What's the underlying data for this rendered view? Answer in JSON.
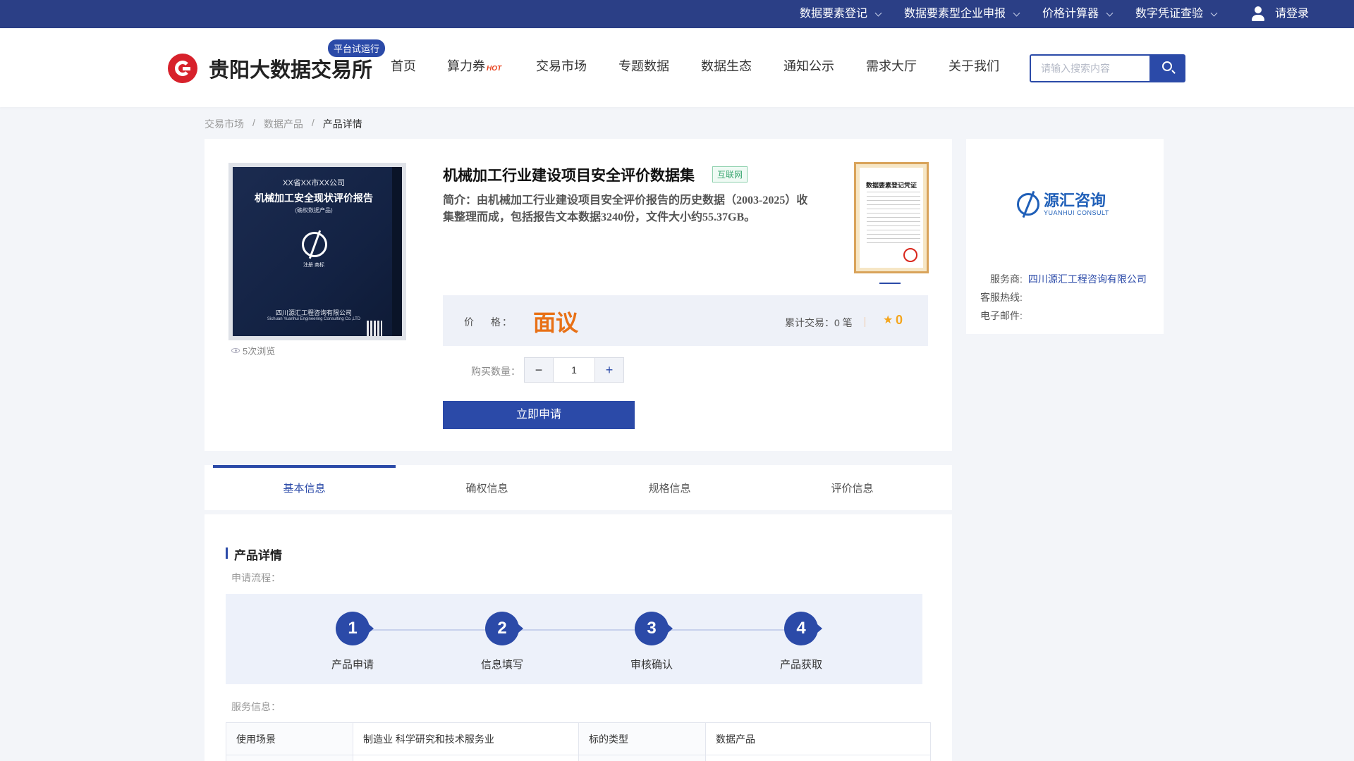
{
  "topbar": {
    "items": [
      {
        "label": "数据要素登记"
      },
      {
        "label": "数据要素型企业申报"
      },
      {
        "label": "价格计算器"
      },
      {
        "label": "数字凭证查验"
      }
    ],
    "login": "请登录"
  },
  "header": {
    "logo_text": "贵阳大数据交易所",
    "trial_badge": "平台试运行",
    "nav": [
      {
        "label": "首页"
      },
      {
        "label": "算力券",
        "badge": "HOT"
      },
      {
        "label": "交易市场"
      },
      {
        "label": "专题数据"
      },
      {
        "label": "数据生态"
      },
      {
        "label": "通知公示"
      },
      {
        "label": "需求大厅"
      },
      {
        "label": "关于我们"
      }
    ],
    "search_placeholder": "请输入搜索内容"
  },
  "breadcrumb": [
    "交易市场",
    "数据产品",
    "产品详情"
  ],
  "breadcrumb_sep": "/",
  "product": {
    "cover": {
      "line1": "XX省XX市XX公司",
      "line2": "机械加工安全现状评价报告",
      "line3": "(确权数据产品)",
      "logo_label": "注册  商标",
      "company": "四川源汇工程咨询有限公司",
      "company_en": "Sichuan Yuanhui Engineering Consulting Co.,LTD"
    },
    "views": "5次浏览",
    "title": "机械加工行业建设项目安全评价数据集",
    "tag": "互联网",
    "description": "简介：由机械加工行业建设项目安全评价报告的历史数据（2003-2025）收集整理而成，包括报告文本数据3240份，文件大小约55.37GB。",
    "certificate_title": "数据要素登记凭证",
    "price_label": "价  格：",
    "price_value": "面议",
    "trade_count": "累计交易：0 笔",
    "rating": "0",
    "quantity_label": "购买数量：",
    "quantity": "1",
    "minus": "−",
    "plus": "+",
    "apply_button": "立即申请"
  },
  "provider": {
    "logo_cn": "源汇咨询",
    "logo_en": "YUANHUI CONSULT",
    "service_label": "服务商:",
    "service_value": "四川源汇工程咨询有限公司",
    "hotline_label": "客服热线:",
    "email_label": "电子邮件:"
  },
  "tabs": [
    {
      "label": "基本信息",
      "active": true
    },
    {
      "label": "确权信息"
    },
    {
      "label": "规格信息"
    },
    {
      "label": "评价信息"
    }
  ],
  "detail": {
    "section_title": "产品详情",
    "flow_label": "申请流程：",
    "steps": [
      {
        "num": "1",
        "label": "产品申请"
      },
      {
        "num": "2",
        "label": "信息填写"
      },
      {
        "num": "3",
        "label": "审核确认"
      },
      {
        "num": "4",
        "label": "产品获取"
      }
    ],
    "service_label": "服务信息：",
    "table": [
      [
        "使用场景",
        "制造业 科学研究和技术服务业",
        "标的类型",
        "数据产品"
      ]
    ]
  },
  "colors": {
    "primary": "#2b4aa8",
    "topbar": "#2b3f86",
    "price": "#e87117",
    "star": "#f4a51c",
    "logo_red": "#d7212b"
  }
}
